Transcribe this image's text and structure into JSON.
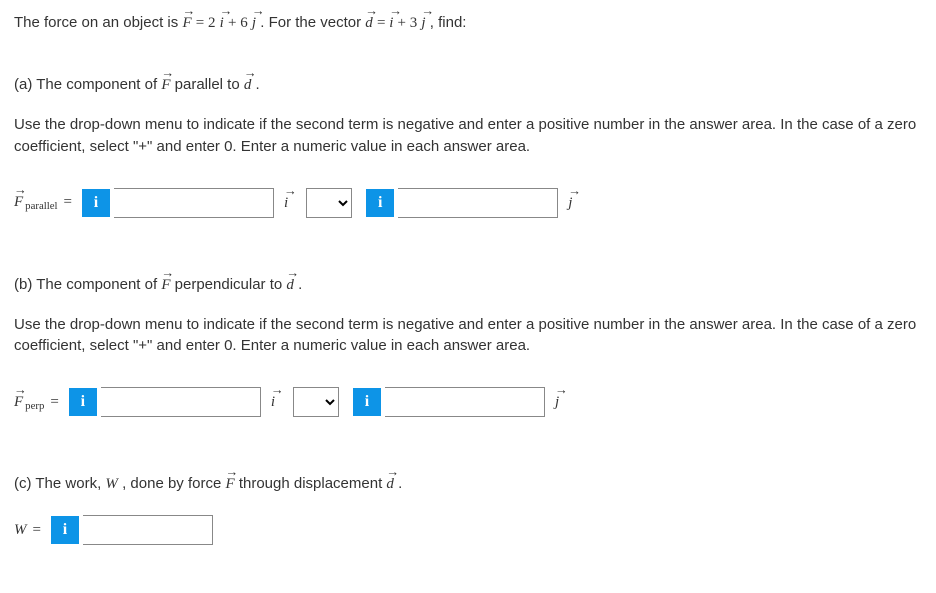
{
  "problem": {
    "intro_pre": "The force on an object is ",
    "F_label": "F",
    "eq1": " = 2",
    "i": "i",
    "plus6": " + 6",
    "j": "j",
    "intro_mid": " . For the vector ",
    "d_label": "d",
    "eq2": " = ",
    "plus3": " + 3",
    "intro_post": " , find:"
  },
  "parts": {
    "a": {
      "label": "(a) The component of ",
      "after": " parallel to ",
      "end": "."
    },
    "b": {
      "label": "(b) The component of ",
      "after": " perpendicular to ",
      "end": "."
    },
    "c": {
      "label": "(c) The work, ",
      "W": "W",
      "mid": ", done by force ",
      "mid2": " through displacement ",
      "end": "."
    }
  },
  "instruction": "Use the drop-down menu to indicate if the second term is negative and enter a positive number in the answer area. In the case of a zero coefficient, select \"+\" and enter 0. Enter a numeric value in each answer area.",
  "answers": {
    "parallel_label": "F",
    "parallel_sub": "parallel",
    "perp_label": "F",
    "perp_sub": "perp",
    "equals": " = ",
    "W_label": "W",
    "i_unit": "i",
    "j_unit": "j",
    "info": "i",
    "sign_default": "",
    "val1": "",
    "val2": "",
    "val3": "",
    "val4": "",
    "val5": ""
  }
}
